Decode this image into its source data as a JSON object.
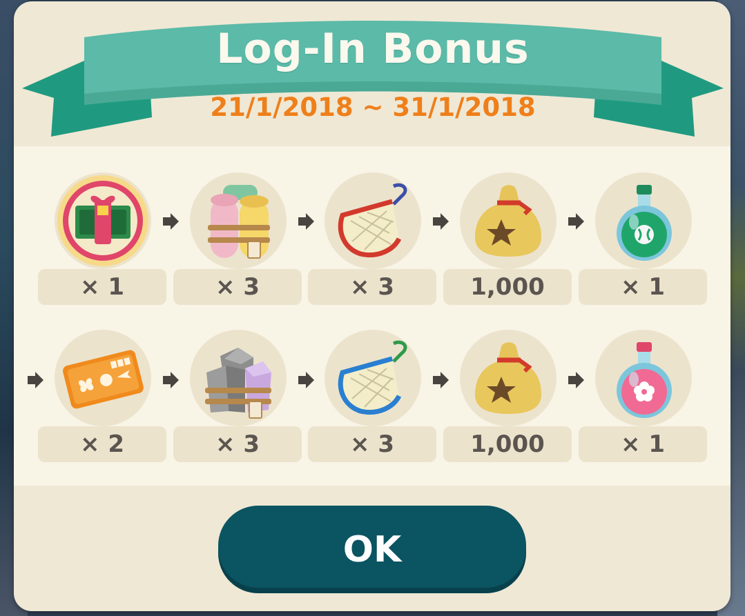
{
  "dialog": {
    "title": "Log-In Bonus",
    "date_range": "21/1/2018 ~ 31/1/2018"
  },
  "rewards": [
    {
      "icon": "gift-ticket-icon",
      "count": "× 1"
    },
    {
      "icon": "fabric-rolls-icon",
      "count": "× 3"
    },
    {
      "icon": "red-net-icon",
      "count": "× 3"
    },
    {
      "icon": "bell-bag-icon",
      "count": "1,000"
    },
    {
      "icon": "green-potion-icon",
      "count": "× 1"
    },
    {
      "icon": "orange-ticket-icon",
      "count": "× 2"
    },
    {
      "icon": "stone-bundle-icon",
      "count": "× 3"
    },
    {
      "icon": "blue-net-icon",
      "count": "× 3"
    },
    {
      "icon": "bell-bag-icon",
      "count": "1,000"
    },
    {
      "icon": "pink-potion-icon",
      "count": "× 1"
    }
  ],
  "buttons": {
    "ok_label": "OK"
  },
  "colors": {
    "ribbon": "#5bbaa8",
    "ribbon_dark": "#1f9a80",
    "date": "#ef7f1a",
    "ok_button": "#0b5462",
    "panel": "#efe8d5"
  }
}
